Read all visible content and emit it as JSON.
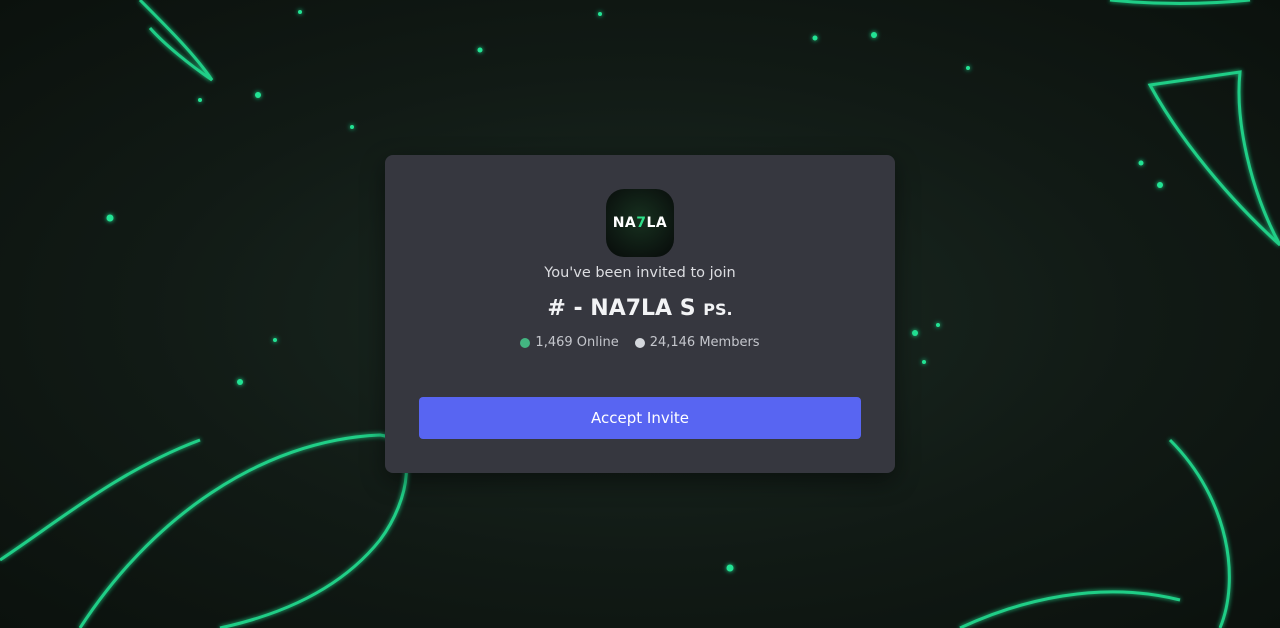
{
  "invite": {
    "server_icon": {
      "icon_name": "server-logo-icon",
      "text_main": "NA",
      "text_accent": "7",
      "text_end": "LA"
    },
    "subtitle": "You've been invited to join",
    "server_name": "# - NA7LA S",
    "server_name_suffix": "PS.",
    "online": {
      "icon_name": "online-status-dot",
      "color": "#43b581",
      "text": "1,469 Online"
    },
    "members": {
      "icon_name": "members-status-dot",
      "color": "#d4d7dc",
      "text": "24,146 Members"
    },
    "accept_label": "Accept Invite"
  },
  "colors": {
    "card_bg": "#36373f",
    "button_bg": "#5865f2",
    "background_accent": "#1fd68a"
  }
}
